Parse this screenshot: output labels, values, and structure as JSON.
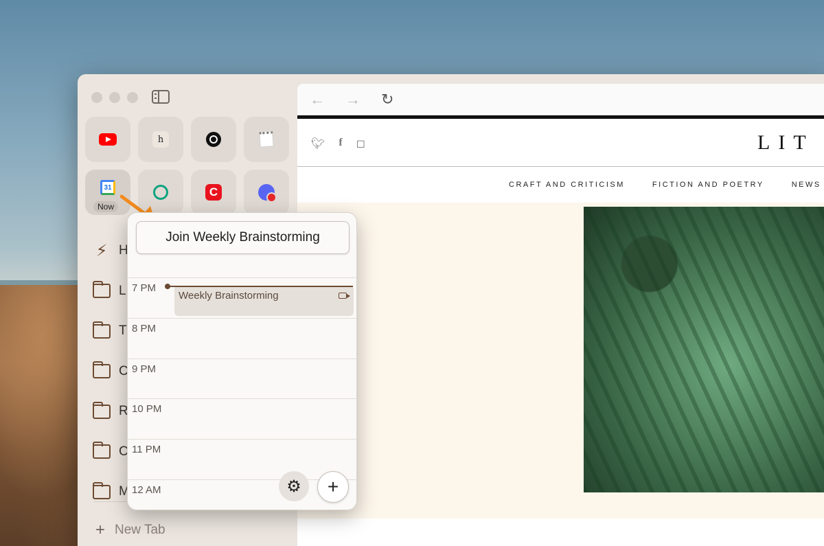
{
  "favorites": {
    "row1": [
      "youtube",
      "hey",
      "circle-app",
      "notes"
    ],
    "row2": [
      "google-calendar",
      "chatgpt",
      "c-app",
      "discord"
    ],
    "calendar_day": "31",
    "now_badge": "Now",
    "hey_letter": "h",
    "c_letter": "C"
  },
  "sidebar": {
    "items": [
      {
        "icon": "bolt-icon",
        "label": "H"
      },
      {
        "icon": "folder-icon",
        "label": "L"
      },
      {
        "icon": "folder-icon",
        "label": "T"
      },
      {
        "icon": "folder-icon",
        "label": "C"
      },
      {
        "icon": "folder-icon",
        "label": "R"
      },
      {
        "icon": "folder-icon",
        "label": "C"
      },
      {
        "icon": "folder-icon",
        "label": "M"
      }
    ],
    "new_tab_label": "New Tab"
  },
  "toolbar": {
    "back": "←",
    "forward": "→",
    "reload": "↻"
  },
  "site": {
    "logo": "LIT",
    "social": [
      "twitter-icon",
      "facebook-icon",
      "instagram-icon"
    ],
    "nav": [
      "CRAFT AND CRITICISM",
      "FICTION AND POETRY",
      "NEWS"
    ],
    "hero_bg": "#fdf6eb"
  },
  "popover": {
    "join_button": "Join Weekly Brainstorming",
    "hours": [
      "7 PM",
      "8 PM",
      "9 PM",
      "10 PM",
      "11 PM",
      "12 AM"
    ],
    "event_title": "Weekly Brainstorming",
    "accent": "#6b4a33"
  },
  "colors": {
    "arrow": "#f28b1e",
    "youtube": "#ff0000",
    "discord": "#5865f2"
  }
}
